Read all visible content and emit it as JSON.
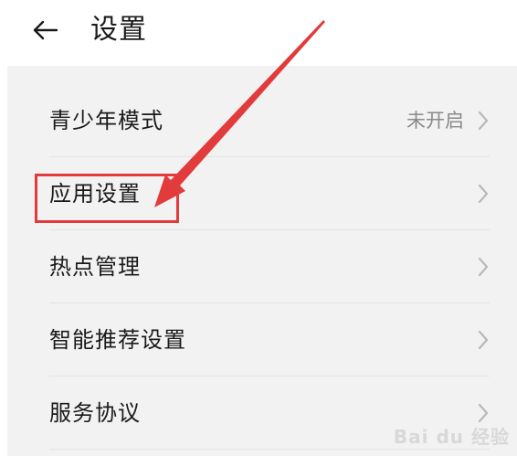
{
  "header": {
    "title": "设置",
    "back_icon": "arrow-left-icon"
  },
  "settings": {
    "items": [
      {
        "label": "青少年模式",
        "value": "未开启"
      },
      {
        "label": "应用设置",
        "value": ""
      },
      {
        "label": "热点管理",
        "value": ""
      },
      {
        "label": "智能推荐设置",
        "value": ""
      },
      {
        "label": "服务协议",
        "value": ""
      }
    ]
  },
  "annotation": {
    "highlight_color": "#e23b3b",
    "highlighted_item": "应用设置"
  },
  "watermark": {
    "text": "Bai du 经验"
  }
}
